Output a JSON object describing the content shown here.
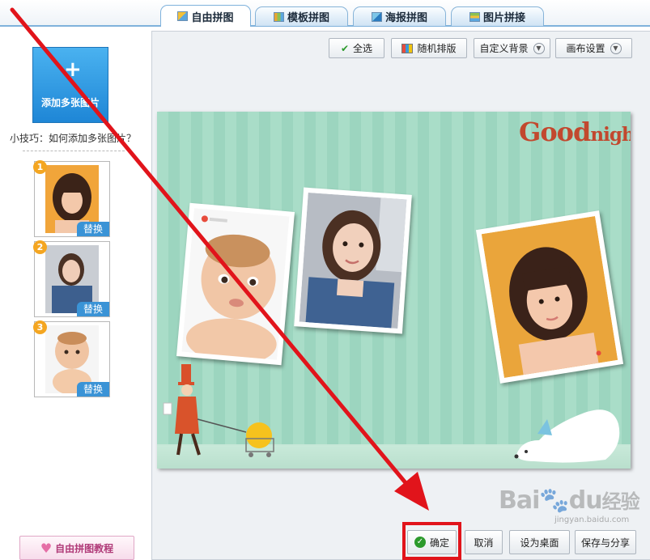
{
  "tabs": [
    {
      "label": "自由拼图",
      "icon": "free-collage-icon",
      "active": true
    },
    {
      "label": "模板拼图",
      "icon": "template-collage-icon",
      "active": false
    },
    {
      "label": "海报拼图",
      "icon": "poster-collage-icon",
      "active": false
    },
    {
      "label": "图片拼接",
      "icon": "image-joint-icon",
      "active": false
    }
  ],
  "sidebar": {
    "add_label": "添加多张图片",
    "tip": "小技巧：如何添加多张图片？",
    "thumbs": [
      {
        "num": "1",
        "replace": "替换"
      },
      {
        "num": "2",
        "replace": "替换"
      },
      {
        "num": "3",
        "replace": "替换"
      }
    ],
    "tutorial_label": "自由拼图教程"
  },
  "toolbar": {
    "select_all": "全选",
    "random_layout": "随机排版",
    "custom_bg": "自定义背景",
    "canvas_settings": "画布设置"
  },
  "canvas": {
    "title_big": "Good",
    "title_small": "night"
  },
  "footer": {
    "ok": "确定",
    "cancel": "取消",
    "set_desktop": "设为桌面",
    "save_share": "保存与分享"
  },
  "watermark": {
    "brand": "Bai",
    "brand2": "du",
    "cn": "经验",
    "url": "jingyan.baidu.com"
  },
  "colors": {
    "accent_blue": "#1e86d6",
    "annotation_red": "#e1141b",
    "canvas_mint": "#a9ddc8",
    "title_red": "#c2482e"
  }
}
